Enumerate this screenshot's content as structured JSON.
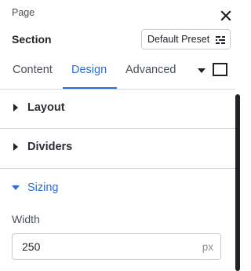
{
  "header": {
    "breadcrumb": "Page",
    "title": "Section",
    "preset_label": "Default Preset"
  },
  "tabs": [
    {
      "label": "Content",
      "active": false
    },
    {
      "label": "Design",
      "active": true
    },
    {
      "label": "Advanced",
      "active": false
    }
  ],
  "sections": [
    {
      "label": "Layout",
      "expanded": false
    },
    {
      "label": "Dividers",
      "expanded": false
    },
    {
      "label": "Sizing",
      "expanded": true
    }
  ],
  "sizing": {
    "width_label": "Width",
    "width_value": "250",
    "width_unit": "px"
  },
  "colors": {
    "accent": "#2c6ed8",
    "text": "#1f2328",
    "muted": "#4a5057",
    "border": "#d5d8dc"
  },
  "icons": {
    "close": "close-icon",
    "preset": "preset-options-icon",
    "more": "caret-down-icon",
    "view": "square-icon"
  }
}
